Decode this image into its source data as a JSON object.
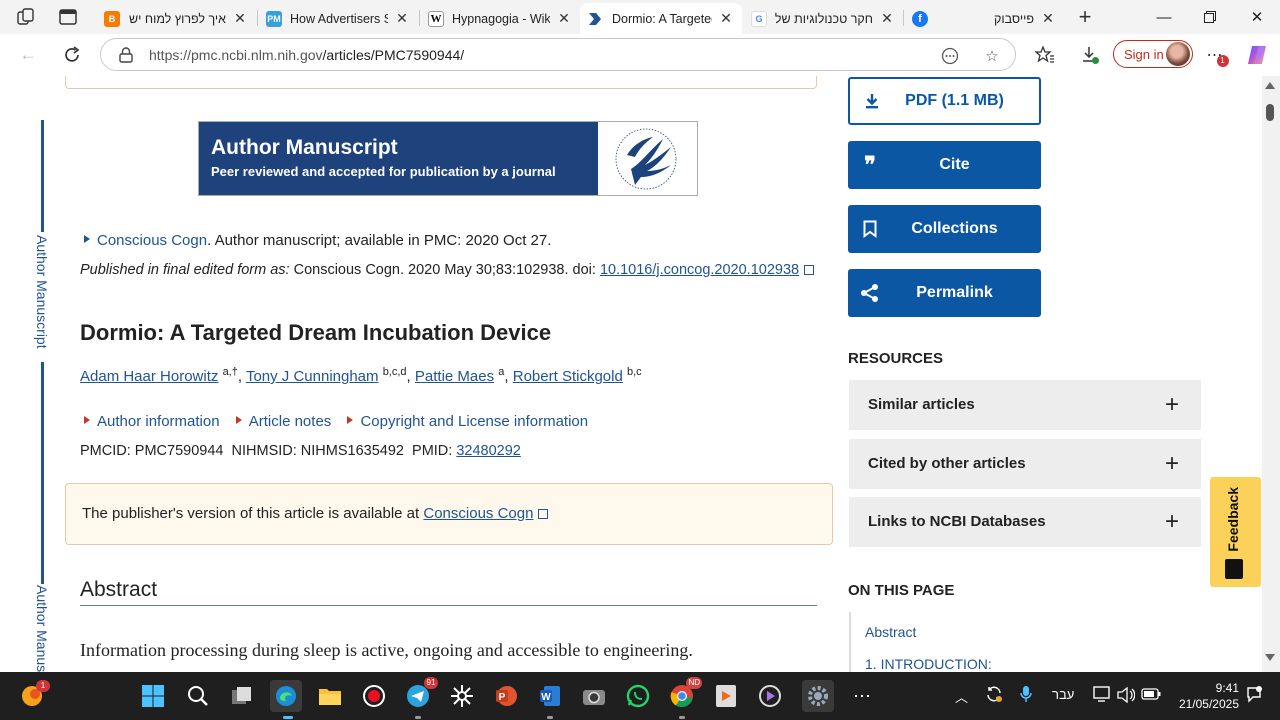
{
  "browser": {
    "tabs": [
      {
        "title": "איך לפרוץ למוח ישן",
        "favicon": "blogger-icon",
        "color": "#f57c00"
      },
      {
        "title": "How Advertisers Se",
        "favicon": "pm-icon",
        "color": "#35a0db",
        "fav_text": "PM"
      },
      {
        "title": "Hypnagogia - Wikip",
        "favicon": "wikipedia-icon",
        "color": "#ffffff",
        "fav_text": "W"
      },
      {
        "title": "Dormio: A Targeted",
        "favicon": "pmc-icon",
        "color": "#205493"
      },
      {
        "title": "חקר טכנולוגיות של",
        "favicon": "google-icon",
        "color": "#ffffff",
        "fav_text": "G"
      },
      {
        "title": "פייסבוק",
        "favicon": "facebook-icon",
        "color": "#1877f2",
        "fav_text": "f"
      }
    ],
    "url_host": "https://pmc.ncbi.nlm.nih.gov",
    "url_path": "/articles/PMC7590944/",
    "signin_label": "Sign in",
    "notification_count": "1"
  },
  "sidebar": {
    "vertical_label": "Author Manuscript"
  },
  "banner": {
    "title": "Author Manuscript",
    "subtitle": "Peer reviewed and accepted for publication by a journal"
  },
  "article": {
    "journal_link": "Conscious Cogn",
    "manuscript_note": ". Author manuscript; available in PMC: 2020 Oct 27.",
    "published_prefix": "Published in final edited form as:",
    "published_text": " Conscious Cogn. 2020 May 30;83:102938. doi: ",
    "doi": "10.1016/j.concog.2020.102938",
    "title": "Dormio: A Targeted Dream Incubation Device",
    "authors": [
      {
        "name": "Adam Haar Horowitz",
        "sup": "a,†"
      },
      {
        "name": "Tony J Cunningham",
        "sup": "b,c,d"
      },
      {
        "name": "Pattie Maes",
        "sup": "a"
      },
      {
        "name": "Robert Stickgold",
        "sup": "b,c"
      }
    ],
    "info_links": [
      "Author information",
      "Article notes",
      "Copyright and License information"
    ],
    "pmcid": "PMCID: PMC7590944",
    "nihmsid": "NIHMSID: NIHMS1635492",
    "pmid_label": "PMID:",
    "pmid": "32480292",
    "publisher_note": "The publisher's version of this article is available at",
    "publisher_link": "Conscious Cogn",
    "abstract_heading": "Abstract",
    "abstract_first_line": "Information processing during sleep is active, ongoing and accessible to engineering."
  },
  "side": {
    "pdf_label": "PDF (1.1 MB)",
    "cite_label": "Cite",
    "collections_label": "Collections",
    "permalink_label": "Permalink",
    "resources_heading": "RESOURCES",
    "resources": [
      "Similar articles",
      "Cited by other articles",
      "Links to NCBI Databases"
    ],
    "on_this_page_heading": "ON THIS PAGE",
    "on_this_page": [
      "Abstract",
      "1. INTRODUCTION:"
    ],
    "feedback_label": "Feedback"
  },
  "taskbar": {
    "copilot_badge": "1",
    "telegram_badge": "91",
    "chrome_badge": "ND",
    "language": "עבר",
    "time": "9:41",
    "date": "21/05/2025"
  }
}
